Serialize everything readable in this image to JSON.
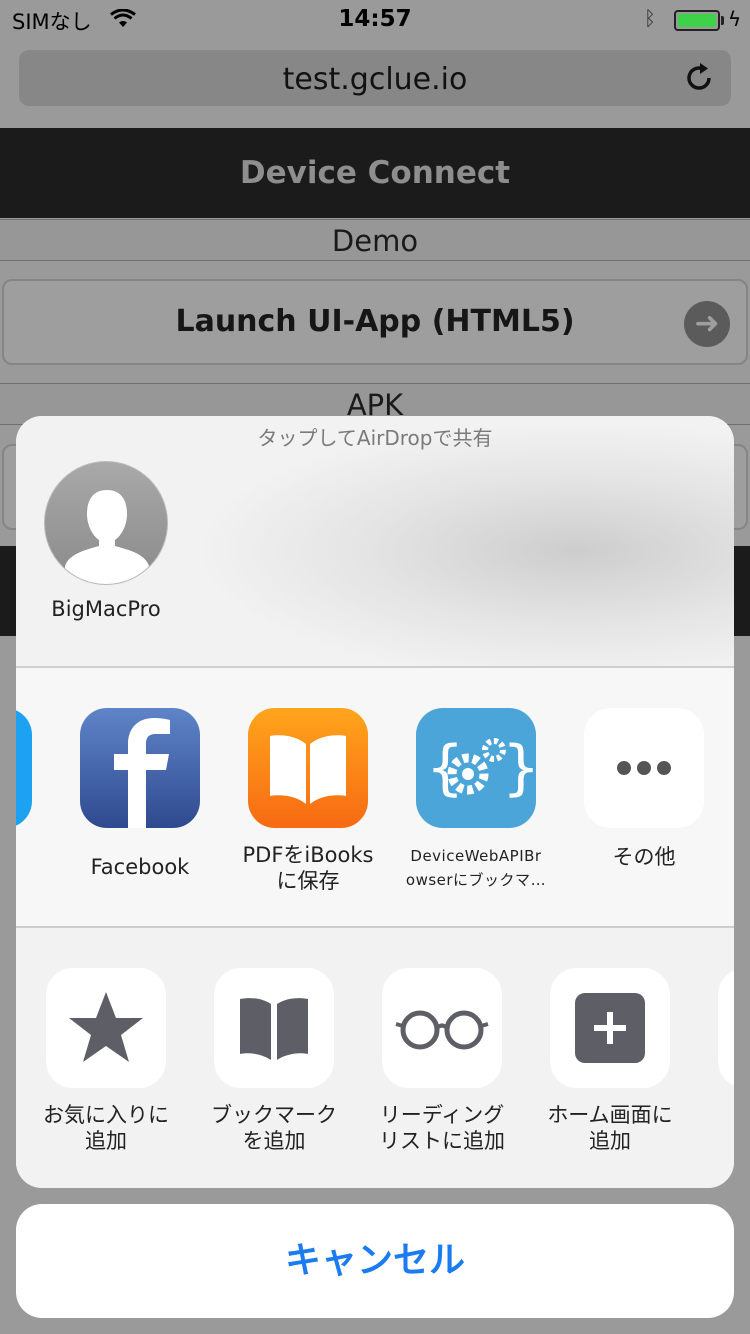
{
  "status_bar": {
    "carrier": "SIMなし",
    "time": "14:57",
    "battery_level": 1.0,
    "bluetooth": "ᛒ",
    "charging": "ϟ"
  },
  "browser": {
    "url": "test.gclue.io"
  },
  "page": {
    "header": "Device Connect",
    "section_demo": "Demo",
    "launch_button": "Launch UI-App (HTML5)",
    "section_apk": "APK"
  },
  "share_sheet": {
    "airdrop_hint": "タップしてAirDropで共有",
    "airdrop_person": "BigMacPro",
    "apps": [
      {
        "label": "Facebook",
        "icon": "facebook-icon"
      },
      {
        "label_line1": "PDFをiBooks",
        "label_line2": "に保存",
        "icon": "ibooks-icon"
      },
      {
        "label_line1": "DeviceWebAPIBr",
        "label_line2": "owserにブックマ…",
        "icon": "gear-code-icon"
      },
      {
        "label": "その他",
        "icon": "more-dots-icon"
      }
    ],
    "actions": [
      {
        "label_line1": "お気に入りに",
        "label_line2": "追加",
        "icon": "star-icon"
      },
      {
        "label_line1": "ブックマーク",
        "label_line2": "を追加",
        "icon": "book-icon"
      },
      {
        "label_line1": "リーディング",
        "label_line2": "リストに追加",
        "icon": "glasses-icon"
      },
      {
        "label_line1": "ホーム画面に",
        "label_line2": "追加",
        "icon": "plus-square-icon"
      }
    ],
    "cancel": "キャンセル"
  },
  "colors": {
    "accent": "#1a7cf0",
    "dim_background": "#9a9a9a"
  }
}
